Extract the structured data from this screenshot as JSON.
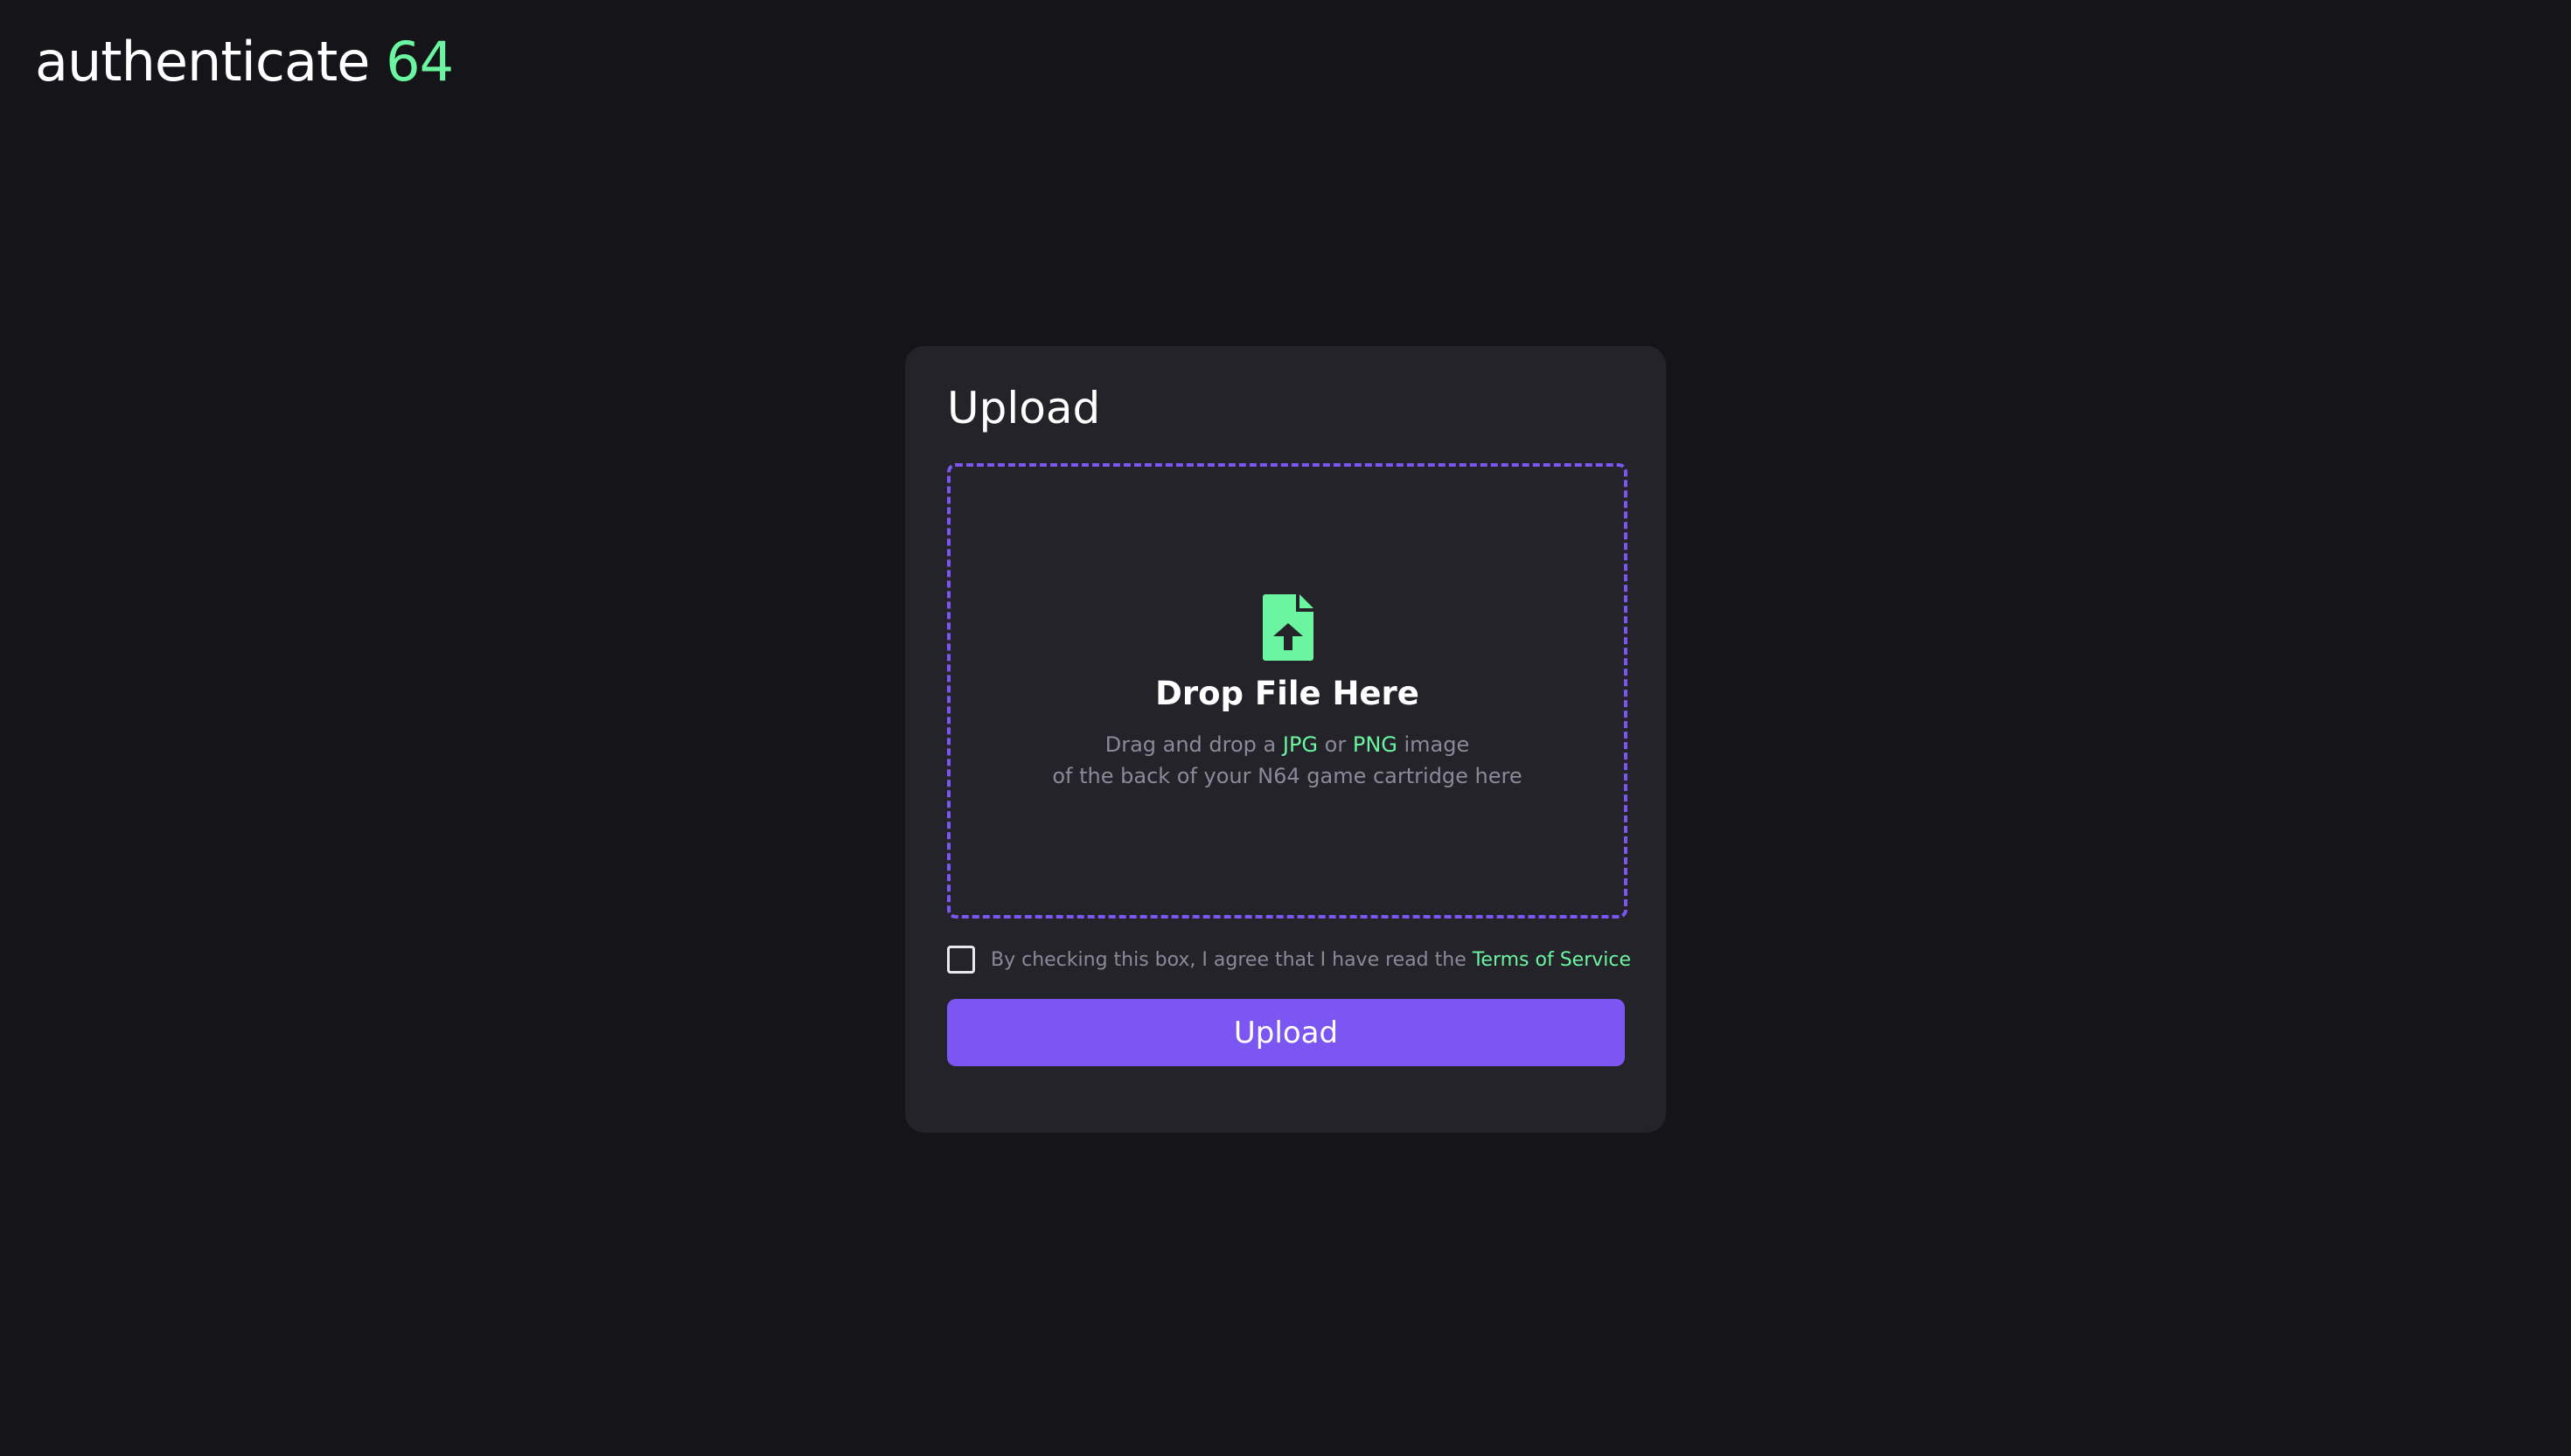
{
  "header": {
    "brand_text": "authenticate",
    "brand_number": "64"
  },
  "upload_card": {
    "title": "Upload",
    "dropzone": {
      "icon": "file-upload-icon",
      "title": "Drop File Here",
      "line1_prefix": "Drag and drop a ",
      "format1": "JPG",
      "line1_or": " or ",
      "format2": "PNG",
      "line1_suffix": " image",
      "line2": "of the back of your N64 game cartridge here"
    },
    "agreement": {
      "checked": false,
      "text": "By checking this box, I agree that I have read the ",
      "link": "Terms of Service"
    },
    "submit_label": "Upload"
  },
  "colors": {
    "background": "#141419",
    "card": "#232329",
    "accent_purple": "#7c56f2",
    "accent_green": "#6cf5a0",
    "muted_text": "#8a8a9a"
  }
}
